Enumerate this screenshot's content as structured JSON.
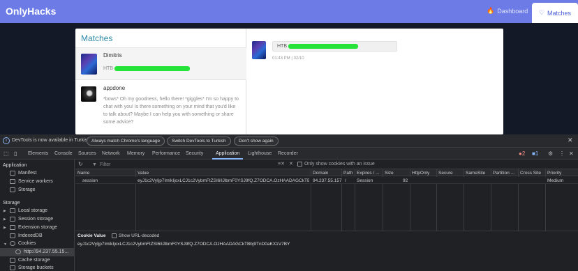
{
  "app": {
    "brand": "OnlyHacks",
    "nav": {
      "dashboard": "Dashboard",
      "matches": "Matches"
    },
    "panel_title": "Matches",
    "matches": [
      {
        "name": "Dimitris",
        "preview_prefix": "HTB"
      },
      {
        "name": "appdone",
        "preview": "*bows* Oh my goodness, hello there! *giggles* I'm so happy to chat with you! Is there something on your mind that you'd like to talk about? Maybe I can help you with something or share some advice?"
      }
    ],
    "chat": {
      "message_prefix": "HTB",
      "time": "01:43 PM | 02/10"
    },
    "colors": {
      "navbar": "#6d7be6",
      "accent": "#2d8aa8",
      "redaction": "#26e33a"
    }
  },
  "devtools": {
    "notice": {
      "text": "DevTools is now available in Turkish!",
      "btn_always": "Always match Chrome's language",
      "btn_switch": "Switch DevTools to Turkish",
      "btn_dont": "Don't show again"
    },
    "tabs": [
      "Elements",
      "Console",
      "Sources",
      "Network",
      "Memory",
      "Performance",
      "Security",
      "Application",
      "Lighthouse",
      "Recorder"
    ],
    "active_tab": "Application",
    "badges": {
      "errors": "2",
      "messages": "1"
    },
    "sidebar": {
      "application_header": "Application",
      "application_items": [
        "Manifest",
        "Service workers",
        "Storage"
      ],
      "storage_header": "Storage",
      "storage_items": [
        "Local storage",
        "Session storage",
        "Extension storage",
        "IndexedDB",
        "Cookies"
      ],
      "cookie_origin": "http://94.237.55.15...",
      "more_items": [
        "Cache storage",
        "Storage buckets"
      ]
    },
    "toolbar": {
      "filter_placeholder": "Filter",
      "only_issue_label": "Only show cookies with an issue"
    },
    "table": {
      "headers": [
        "Name",
        "Value",
        "Domain",
        "Path",
        "Expires / ...",
        "Size",
        "HttpOnly",
        "Secure",
        "SameSite",
        "Partition ...",
        "Cross Site",
        "Priority"
      ],
      "row": {
        "name": "session",
        "value": "eyJ1c2VyIjp7ImlkIjoxLCJ1c2VybmFtZSI6IlJlbmF0YSJ9fQ.Z7ODCA.OzHAADAGCkTBbj9...",
        "domain": "94.237.55.157",
        "path": "/",
        "expires": "Session",
        "size": "92",
        "priority": "Medium"
      }
    },
    "cookie_value": {
      "title": "Cookie Value",
      "show_decoded": "Show URL-decoded",
      "value": "eyJ1c2VyIjp7ImlkIjoxLCJ1c2VybmFtZSI6IlJlbmF0YSJ9fQ.Z7ODCA.OzHAADAGCkTBbj9TnD0aKX1V7BY"
    }
  }
}
